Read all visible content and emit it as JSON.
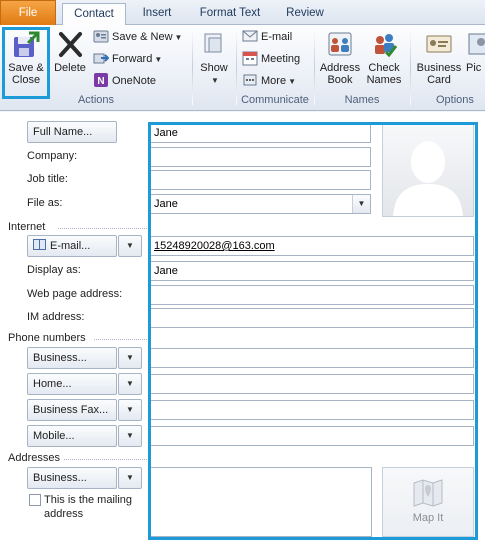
{
  "tabs": {
    "file": "File",
    "contact": "Contact",
    "insert": "Insert",
    "format_text": "Format Text",
    "review": "Review"
  },
  "ribbon": {
    "actions": {
      "label": "Actions",
      "save_close_line1": "Save &",
      "save_close_line2": "Close",
      "delete": "Delete",
      "save_new": "Save & New",
      "forward": "Forward",
      "onenote": "OneNote"
    },
    "show": {
      "label": "Show"
    },
    "communicate": {
      "label": "Communicate",
      "email": "E-mail",
      "meeting": "Meeting",
      "more": "More"
    },
    "names": {
      "label": "Names",
      "address_book_line1": "Address",
      "address_book_line2": "Book",
      "check_names_line1": "Check",
      "check_names_line2": "Names"
    },
    "options": {
      "label": "Options",
      "business_card_line1": "Business",
      "business_card_line2": "Card",
      "picture": "Pic"
    }
  },
  "form": {
    "full_name_button": "Full Name...",
    "full_name_value": "Jane",
    "company_label": "Company:",
    "company_value": "",
    "job_title_label": "Job title:",
    "job_title_value": "",
    "file_as_label": "File as:",
    "file_as_value": "Jane",
    "internet_section": "Internet",
    "email_button": "E-mail...",
    "email_value": "15248920028@163.com",
    "display_as_label": "Display as:",
    "display_as_value": "Jane",
    "web_page_label": "Web page address:",
    "web_page_value": "",
    "im_label": "IM address:",
    "im_value": "",
    "phone_section": "Phone numbers",
    "business_phone_button": "Business...",
    "home_phone_button": "Home...",
    "business_fax_button": "Business Fax...",
    "mobile_button": "Mobile...",
    "addresses_section": "Addresses",
    "business_address_button": "Business...",
    "mailing_address_line1": "This is the mailing",
    "mailing_address_line2": "address",
    "map_it": "Map It"
  },
  "colors": {
    "highlight": "#1d9bd8",
    "file_tab": "#e98a1e"
  }
}
